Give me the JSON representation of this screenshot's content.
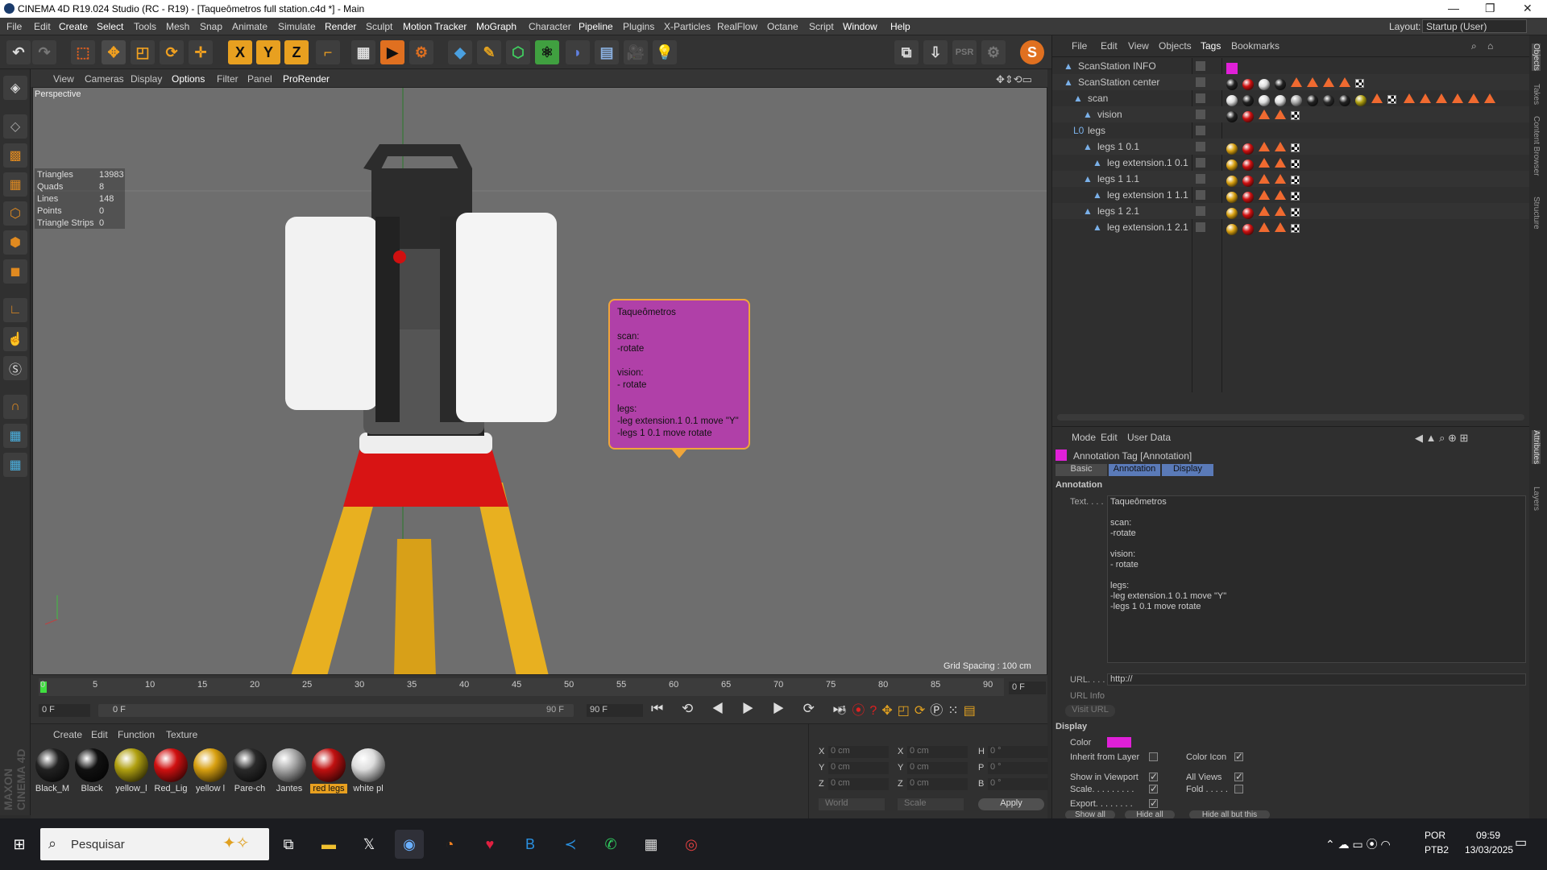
{
  "window": {
    "title": "CINEMA 4D R19.024 Studio (RC - R19) - [Taqueômetros full station.c4d *] - Main"
  },
  "menu": [
    "File",
    "Edit",
    "Create",
    "Select",
    "Tools",
    "Mesh",
    "Snap",
    "Animate",
    "Simulate",
    "Render",
    "Sculpt",
    "Motion Tracker",
    "MoGraph",
    "Character",
    "Pipeline",
    "Plugins",
    "X-Particles",
    "RealFlow",
    "Octane",
    "Script",
    "Window",
    "Help"
  ],
  "layout": {
    "label": "Layout:",
    "value": "Startup (User)"
  },
  "viewport_menu": [
    "View",
    "Cameras",
    "Display",
    "Options",
    "Filter",
    "Panel",
    "ProRender"
  ],
  "viewport": {
    "name": "Perspective",
    "grid_spacing": "Grid Spacing : 100 cm"
  },
  "stats": [
    {
      "k": "Triangles",
      "v": "13983"
    },
    {
      "k": "Quads",
      "v": "8"
    },
    {
      "k": "Lines",
      "v": "148"
    },
    {
      "k": "Points",
      "v": "0"
    },
    {
      "k": "Triangle Strips",
      "v": "0"
    }
  ],
  "annotation_text": "Taqueômetros\n\nscan:\n-rotate\n\nvision:\n- rotate\n\nlegs:\n-leg extension.1 0.1 move \"Y\"\n-legs 1 0.1 move rotate",
  "timeline": {
    "ticks": [
      "0",
      "5",
      "10",
      "15",
      "20",
      "25",
      "30",
      "35",
      "40",
      "45",
      "50",
      "55",
      "60",
      "65",
      "70",
      "75",
      "80",
      "85",
      "90"
    ],
    "current": "0 F",
    "start": "0 F",
    "range_start": "0 F",
    "range_end": "90 F",
    "end": "90 F"
  },
  "materials_menu": [
    "Create",
    "Edit",
    "Function",
    "Texture"
  ],
  "materials": [
    {
      "name": "Black_M",
      "color": "#222"
    },
    {
      "name": "Black",
      "color": "#111"
    },
    {
      "name": "yellow_l",
      "color": "#b0a010"
    },
    {
      "name": "Red_Lig",
      "color": "#d01010"
    },
    {
      "name": "yellow l",
      "color": "#d8a010"
    },
    {
      "name": "Pare-ch",
      "color": "#2a2a2a"
    },
    {
      "name": "Jantes",
      "color": "#aaa"
    },
    {
      "name": "red legs",
      "color": "#c01010"
    },
    {
      "name": "white pl",
      "color": "#ddd"
    }
  ],
  "coords": {
    "rows": [
      {
        "a": "X",
        "av": "0 cm",
        "b": "X",
        "bv": "0 cm",
        "c": "H",
        "cv": "0 °"
      },
      {
        "a": "Y",
        "av": "0 cm",
        "b": "Y",
        "bv": "0 cm",
        "c": "P",
        "cv": "0 °"
      },
      {
        "a": "Z",
        "av": "0 cm",
        "b": "Z",
        "bv": "0 cm",
        "c": "B",
        "cv": "0 °"
      }
    ],
    "world": "World",
    "scale": "Scale",
    "apply": "Apply"
  },
  "objects_menu": [
    "File",
    "Edit",
    "View",
    "Objects",
    "Tags",
    "Bookmarks"
  ],
  "objects": [
    {
      "name": "ScanStation INFO",
      "indent": 0
    },
    {
      "name": "ScanStation center",
      "indent": 0
    },
    {
      "name": "scan",
      "indent": 1
    },
    {
      "name": "vision",
      "indent": 2
    },
    {
      "name": "legs",
      "indent": 1
    },
    {
      "name": "legs 1 0.1",
      "indent": 2
    },
    {
      "name": "leg extension.1 0.1",
      "indent": 3
    },
    {
      "name": "legs 1 1.1",
      "indent": 2
    },
    {
      "name": "leg extension 1 1.1",
      "indent": 3
    },
    {
      "name": "legs 1 2.1",
      "indent": 2
    },
    {
      "name": "leg extension.1 2.1",
      "indent": 3
    }
  ],
  "attr_menu": [
    "Mode",
    "Edit",
    "User Data"
  ],
  "attr": {
    "title": "Annotation Tag [Annotation]",
    "tabs": [
      "Basic",
      "Annotation",
      "Display"
    ],
    "section": "Annotation",
    "text_label": "Text. . . .",
    "url_label": "URL. . . .",
    "url_value": "http://",
    "url_info": "URL Info",
    "visit": "Visit URL",
    "display": "Display",
    "color_label": "Color",
    "inherit": "Inherit from Layer",
    "color_icon": "Color Icon",
    "show_vp": "Show in Viewport",
    "all_views": "All Views",
    "scale": "Scale. . . . . . . . .",
    "fold": "Fold . . . . .",
    "export": "Export. . . . . . . .",
    "btn_show": "Show all",
    "btn_hide": "Hide all",
    "btn_hide_but": "Hide all but this",
    "swatch": "#e020d8"
  },
  "taskbar": {
    "search": "Pesquisar",
    "lang1": "POR",
    "lang2": "PTB2",
    "time": "09:59",
    "date": "13/03/2025"
  },
  "right_tabs": [
    "Objects",
    "Takes",
    "Content Browser",
    "Structure",
    "Attributes",
    "Layers"
  ]
}
